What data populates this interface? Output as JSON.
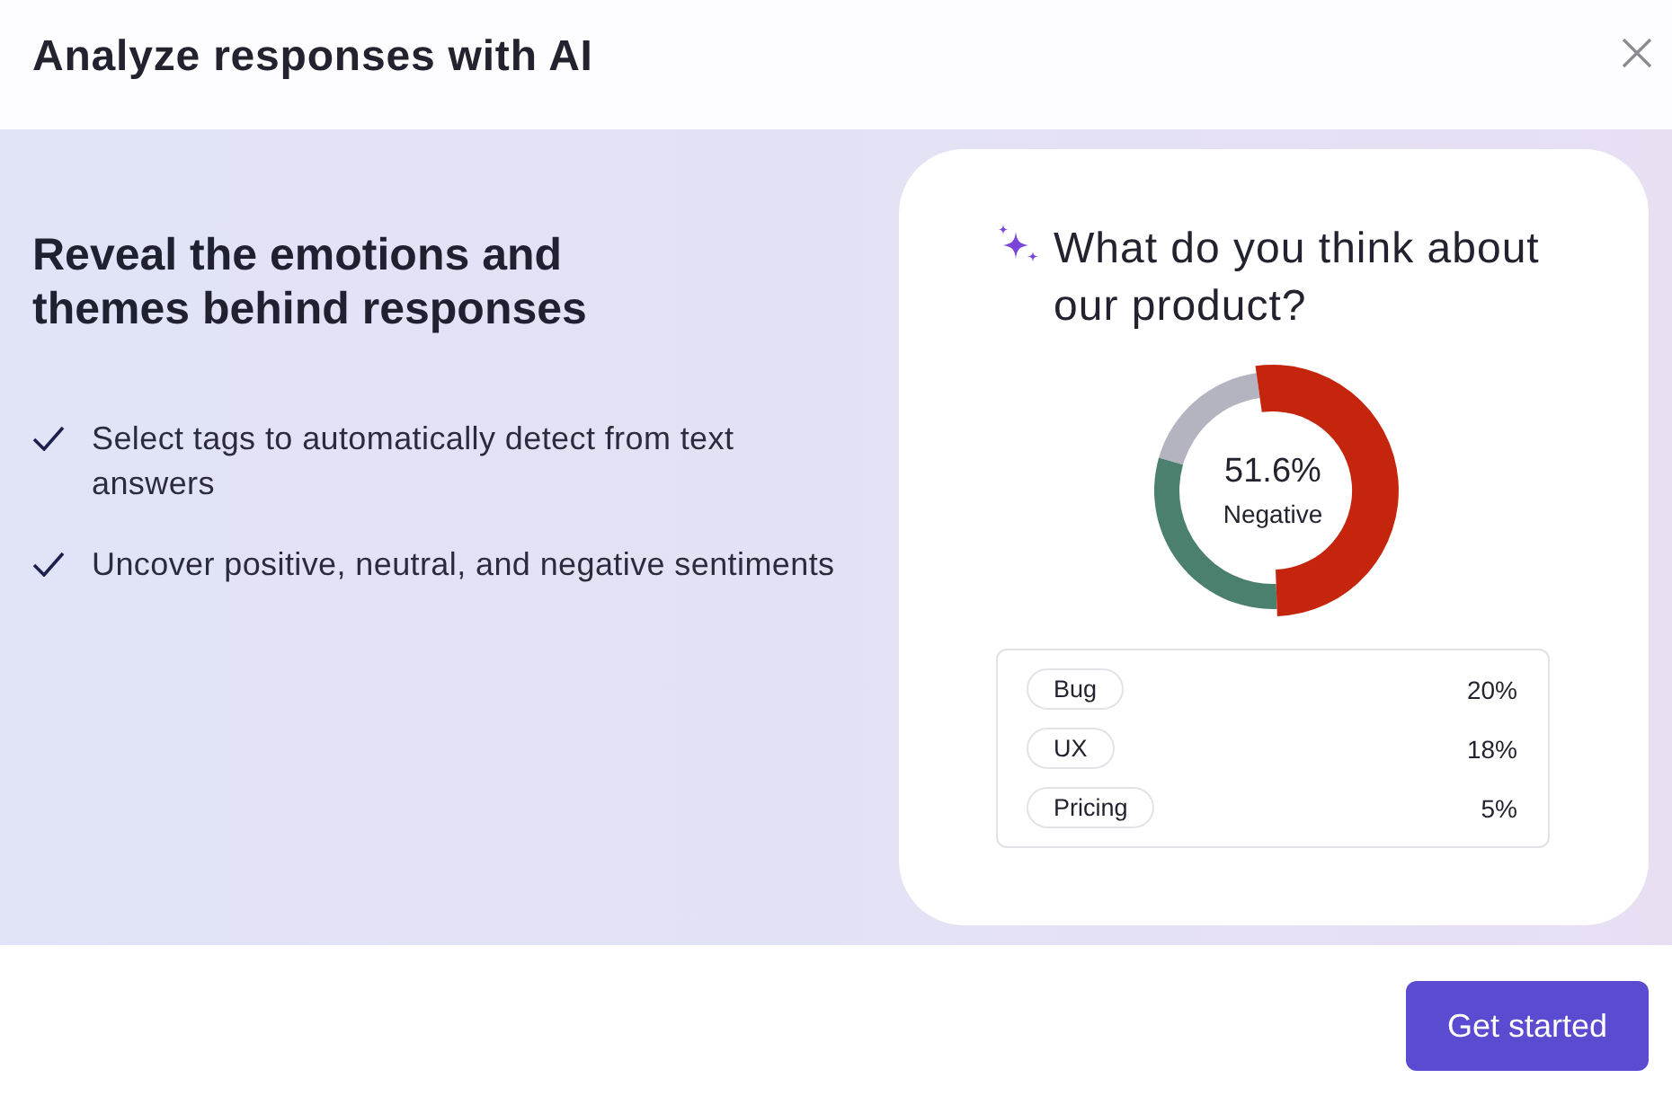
{
  "header": {
    "title": "Analyze responses with AI"
  },
  "intro": {
    "heading": "Reveal the emotions and themes behind responses",
    "features": [
      "Select tags to automatically detect from text answers",
      "Uncover positive, neutral, and negative sentiments"
    ]
  },
  "preview": {
    "question": "What do you think about our product?",
    "donut": {
      "value": "51.6%",
      "label": "Negative"
    },
    "tags": [
      {
        "name": "Bug",
        "share": "20%"
      },
      {
        "name": "UX",
        "share": "18%"
      },
      {
        "name": "Pricing",
        "share": "5%"
      }
    ]
  },
  "footer": {
    "button": "Get started"
  }
}
